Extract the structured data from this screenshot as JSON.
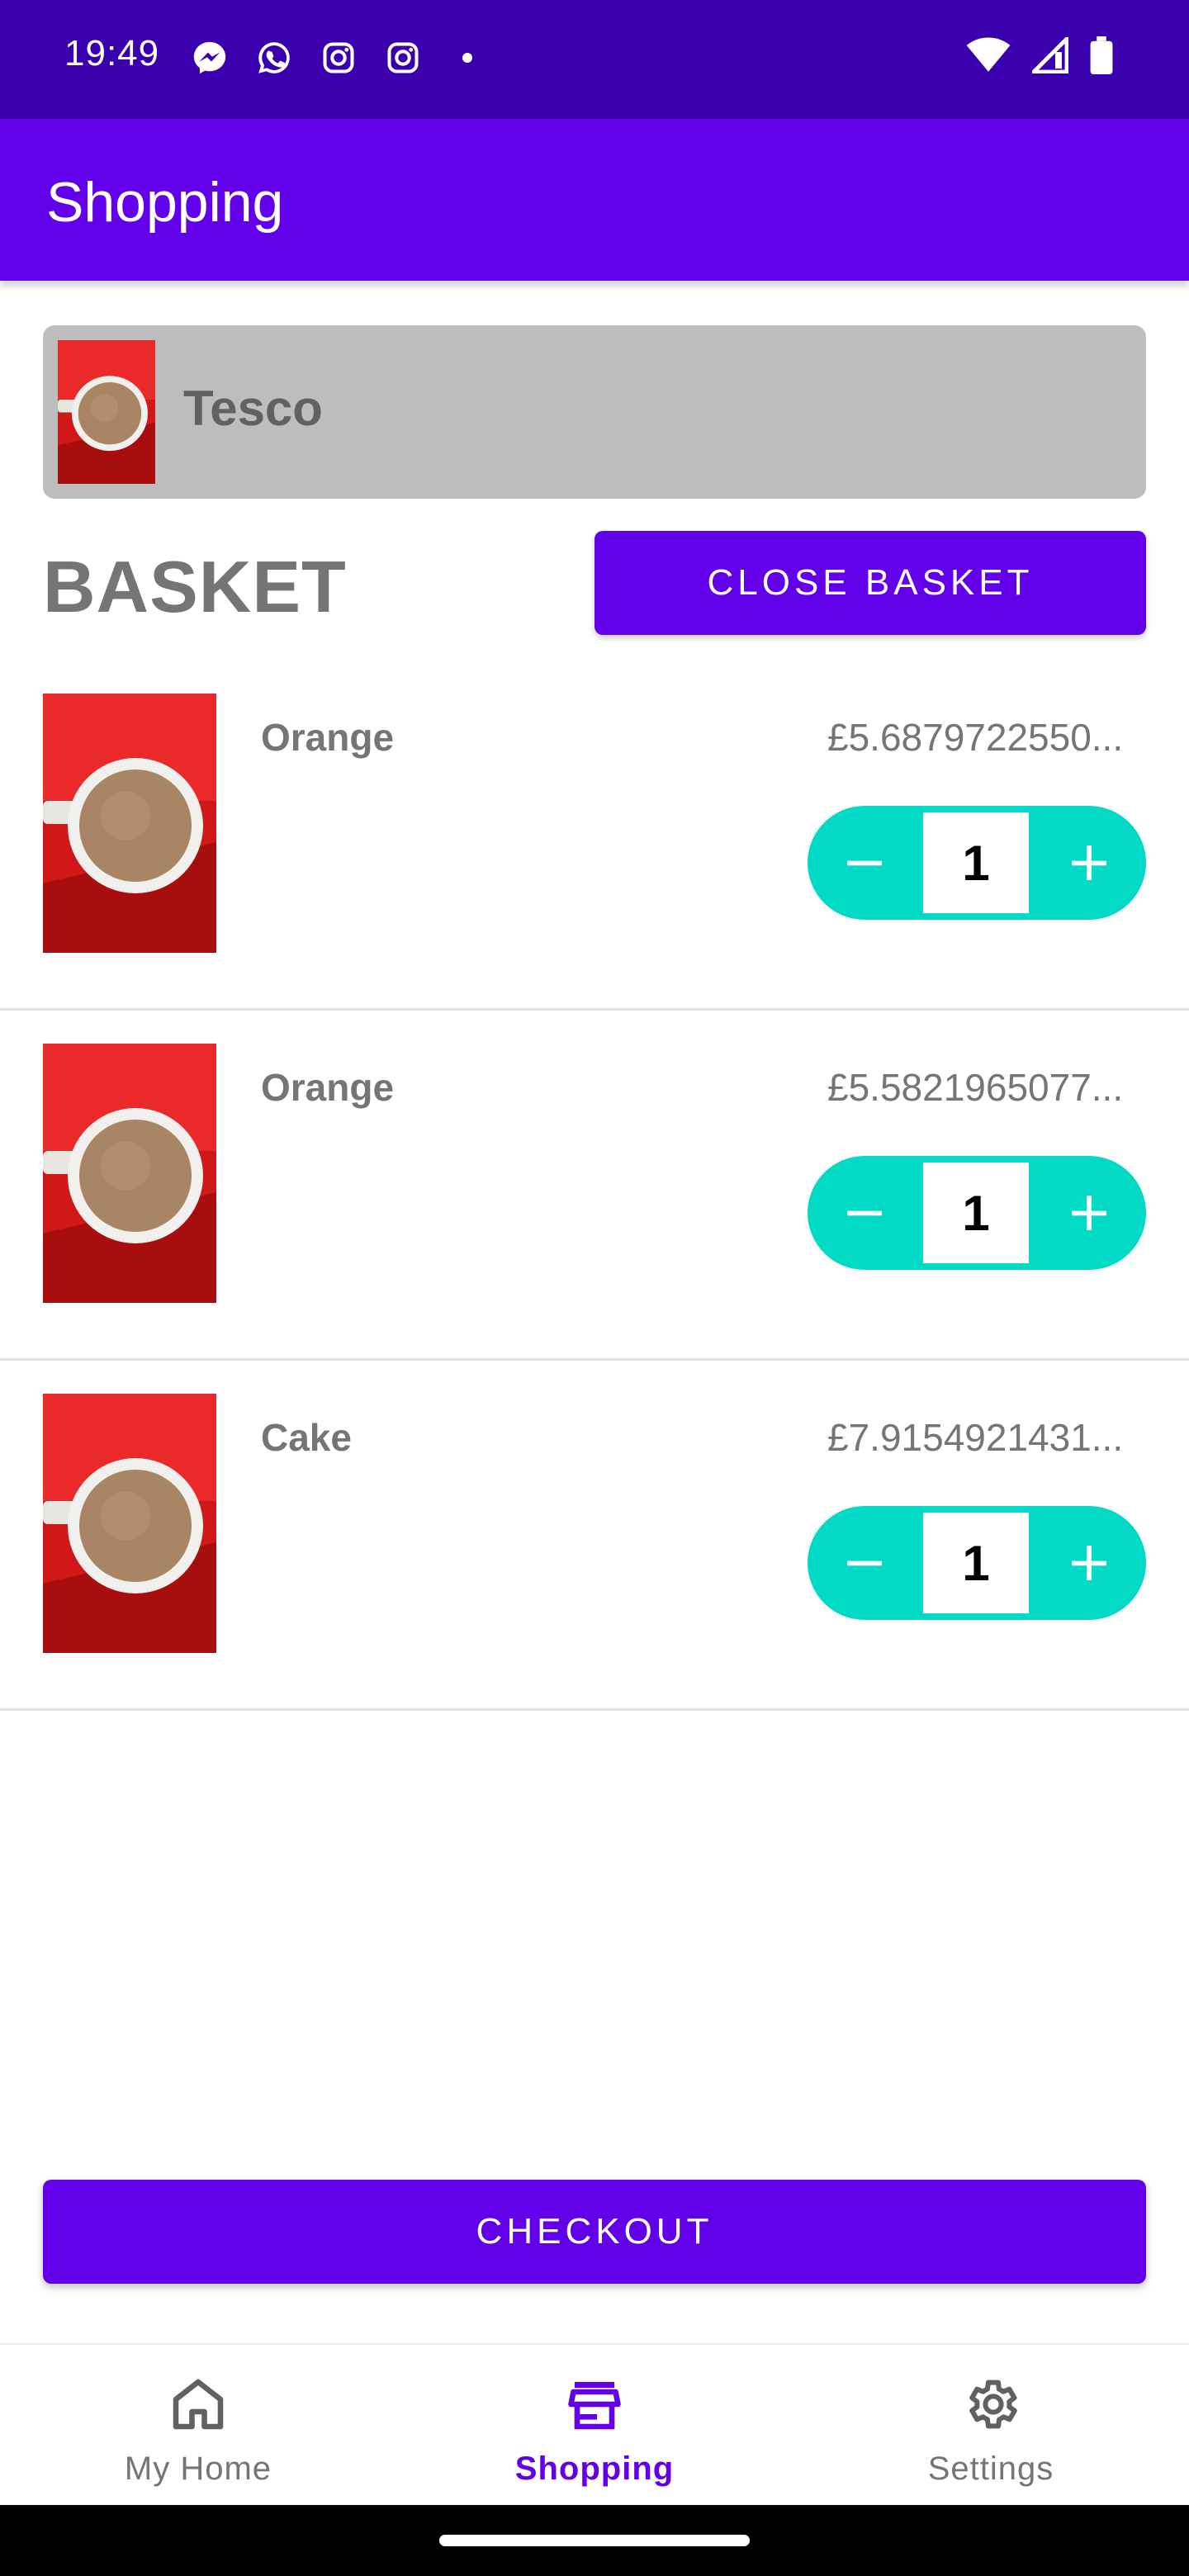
{
  "status_bar": {
    "time": "19:49",
    "notification_icons": [
      "messenger-icon",
      "whatsapp-icon",
      "instagram-icon",
      "instagram-icon",
      "dot-icon"
    ],
    "system_icons": [
      "wifi-icon",
      "signal-icon",
      "battery-icon"
    ]
  },
  "app_bar": {
    "title": "Shopping"
  },
  "store": {
    "name": "Tesco"
  },
  "basket": {
    "title": "BASKET",
    "close_label": "CLOSE BASKET",
    "items": [
      {
        "name": "Orange",
        "price": "£5.6879722550...",
        "quantity": "1"
      },
      {
        "name": "Orange",
        "price": "£5.5821965077...",
        "quantity": "1"
      },
      {
        "name": "Cake",
        "price": "£7.9154921431...",
        "quantity": "1"
      }
    ]
  },
  "checkout": {
    "label": "CHECKOUT"
  },
  "bottom_nav": {
    "items": [
      {
        "label": "My Home",
        "icon": "home-icon"
      },
      {
        "label": "Shopping",
        "icon": "store-icon",
        "active": true
      },
      {
        "label": "Settings",
        "icon": "gear-icon"
      }
    ]
  },
  "colors": {
    "status_bar": "#3a00ad",
    "primary": "#6200ea",
    "stepper": "#03dac5",
    "store_card": "#bdbdbd"
  }
}
